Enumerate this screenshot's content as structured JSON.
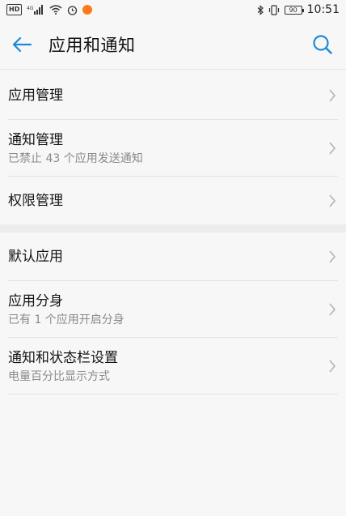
{
  "status_bar": {
    "hd_label": "HD",
    "signal_label": "4G",
    "battery": "90",
    "time": "10:51"
  },
  "header": {
    "title": "应用和通知"
  },
  "groups": [
    {
      "items": [
        {
          "title": "应用管理",
          "subtitle": ""
        },
        {
          "title": "通知管理",
          "subtitle": "已禁止 43 个应用发送通知"
        },
        {
          "title": "权限管理",
          "subtitle": ""
        }
      ]
    },
    {
      "items": [
        {
          "title": "默认应用",
          "subtitle": ""
        },
        {
          "title": "应用分身",
          "subtitle": "已有 1 个应用开启分身"
        },
        {
          "title": "通知和状态栏设置",
          "subtitle": "电量百分比显示方式"
        }
      ]
    }
  ],
  "colors": {
    "accent": "#1c8ad8",
    "background": "#f7f7f7",
    "subtext": "#8a8a8a"
  },
  "icons": {
    "back": "arrow-left-icon",
    "search": "search-icon",
    "chevron": "chevron-right-icon"
  }
}
